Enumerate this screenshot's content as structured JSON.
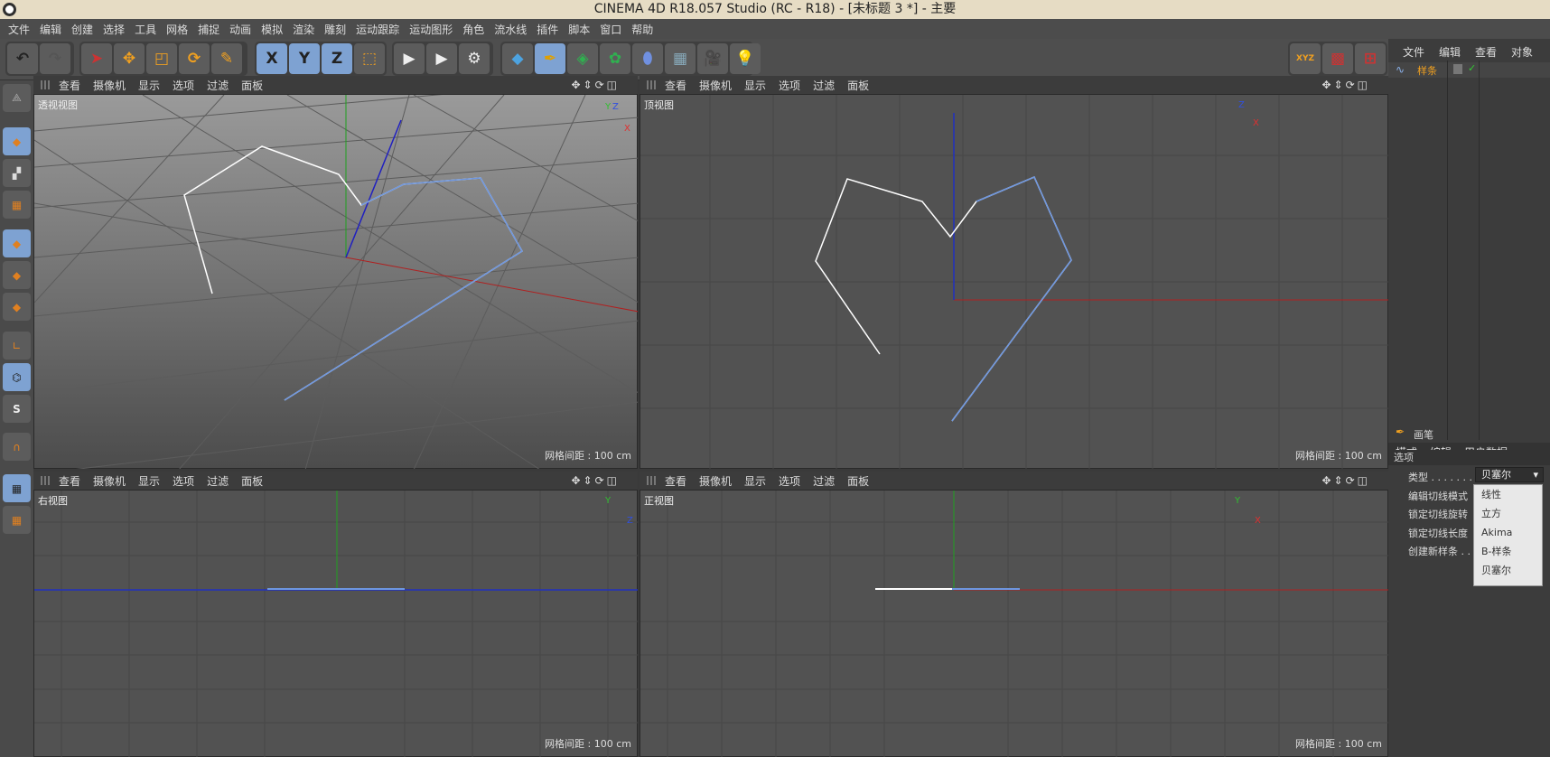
{
  "window": {
    "title": "CINEMA 4D R18.057 Studio (RC - R18) - [未标题 3 *] - 主要"
  },
  "menu": [
    "文件",
    "编辑",
    "创建",
    "选择",
    "工具",
    "网格",
    "捕捉",
    "动画",
    "模拟",
    "渲染",
    "雕刻",
    "运动跟踪",
    "运动图形",
    "角色",
    "流水线",
    "插件",
    "脚本",
    "窗口",
    "帮助"
  ],
  "toolbar": {
    "axis_x": "X",
    "axis_y": "Y",
    "axis_z": "Z",
    "xyz_icon": "XYZ"
  },
  "viewport_menu": {
    "view": "查看",
    "camera": "摄像机",
    "display": "显示",
    "options": "选项",
    "filter": "过滤",
    "panel": "面板"
  },
  "viewports": {
    "perspective": {
      "name": "透视视图",
      "grid": "网格间距 : 100 cm",
      "axis_y": "Y",
      "axis_z": "Z",
      "axis_x": "X"
    },
    "top": {
      "name": "顶视图",
      "grid": "网格间距 : 100 cm",
      "axis_a": "Z",
      "axis_b": "X"
    },
    "right": {
      "name": "右视图",
      "grid": "网格间距 : 100 cm",
      "axis_a": "Y",
      "axis_b": "Z"
    },
    "front": {
      "name": "正视图",
      "grid": "网格间距 : 100 cm",
      "axis_a": "Y",
      "axis_b": "X"
    }
  },
  "object_manager": {
    "menu": [
      "文件",
      "编辑",
      "查看",
      "对象"
    ],
    "object_name": "样条"
  },
  "attribute_manager": {
    "menu": [
      "模式",
      "编辑",
      "用户数据"
    ],
    "tool_name": "画笔",
    "section": "选项",
    "rows": {
      "type": "类型 . . . . . . .",
      "edit_tangent": "编辑切线模式",
      "lock_rotation": "锁定切线旋转",
      "lock_length": "锁定切线长度",
      "new_spline": "创建新样条 . ."
    },
    "type_value": "贝塞尔",
    "type_options": [
      "线性",
      "立方",
      "Akima",
      "B-样条",
      "贝塞尔"
    ]
  }
}
